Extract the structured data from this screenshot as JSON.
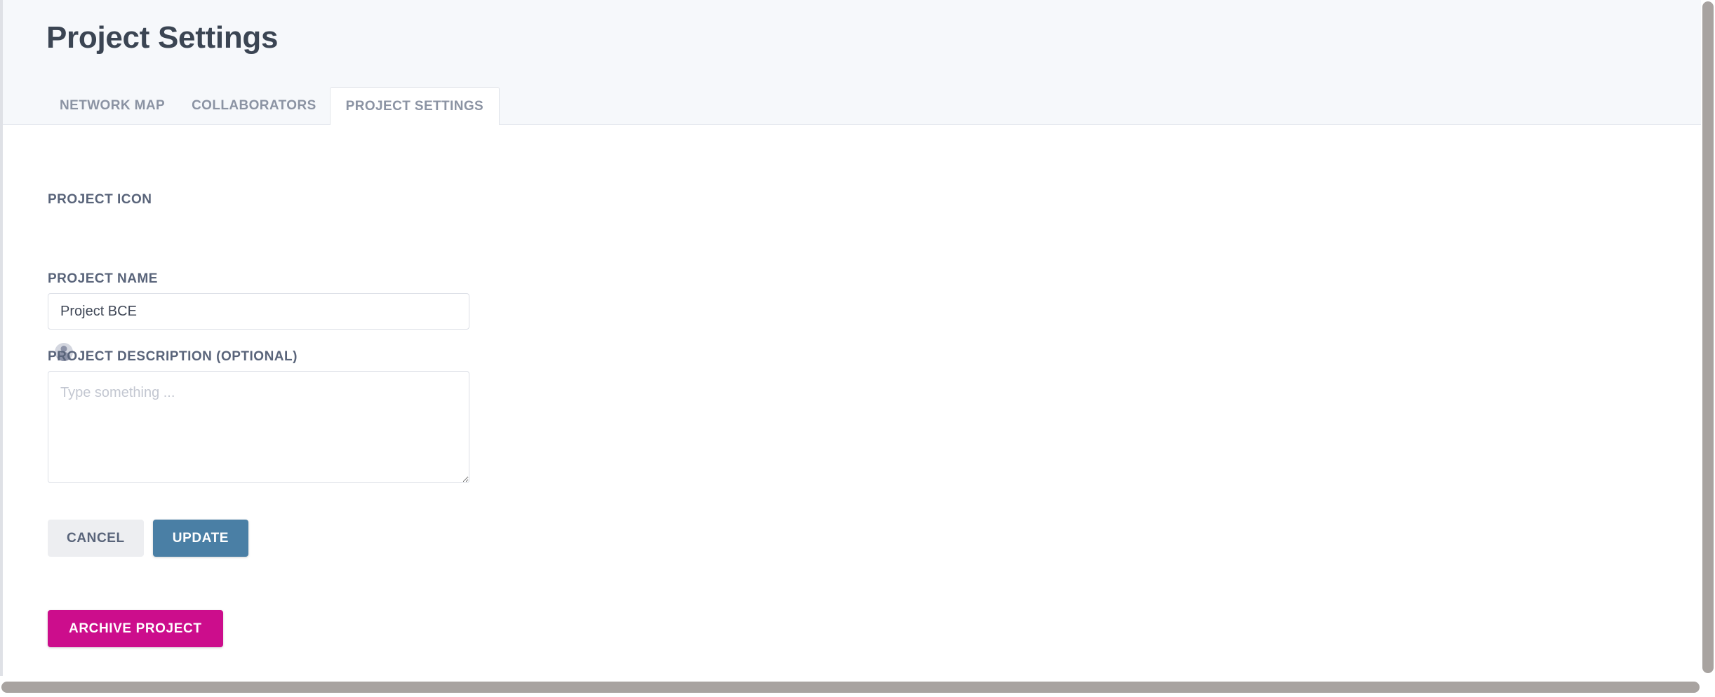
{
  "header": {
    "title": "Project Settings"
  },
  "tabs": [
    {
      "label": "NETWORK MAP",
      "active": false
    },
    {
      "label": "COLLABORATORS",
      "active": false
    },
    {
      "label": "PROJECT SETTINGS",
      "active": true
    }
  ],
  "form": {
    "icon_label": "PROJECT ICON",
    "icon_name": "user-avatar-icon",
    "name_label": "PROJECT NAME",
    "name_value": "Project BCE",
    "description_label": "PROJECT DESCRIPTION (OPTIONAL)",
    "description_value": "",
    "description_placeholder": "Type something ..."
  },
  "actions": {
    "cancel_label": "CANCEL",
    "update_label": "UPDATE",
    "archive_label": "ARCHIVE PROJECT"
  },
  "colors": {
    "header_band": "#f6f8fb",
    "title_text": "#3b4553",
    "tab_text": "#8b93a3",
    "label_text": "#59647a",
    "input_border": "#dcdfe6",
    "update_blue": "#4a7fa5",
    "cancel_gray": "#edeef1",
    "archive_magenta": "#cc0d8c",
    "scrollbar": "#a8a3a0"
  }
}
